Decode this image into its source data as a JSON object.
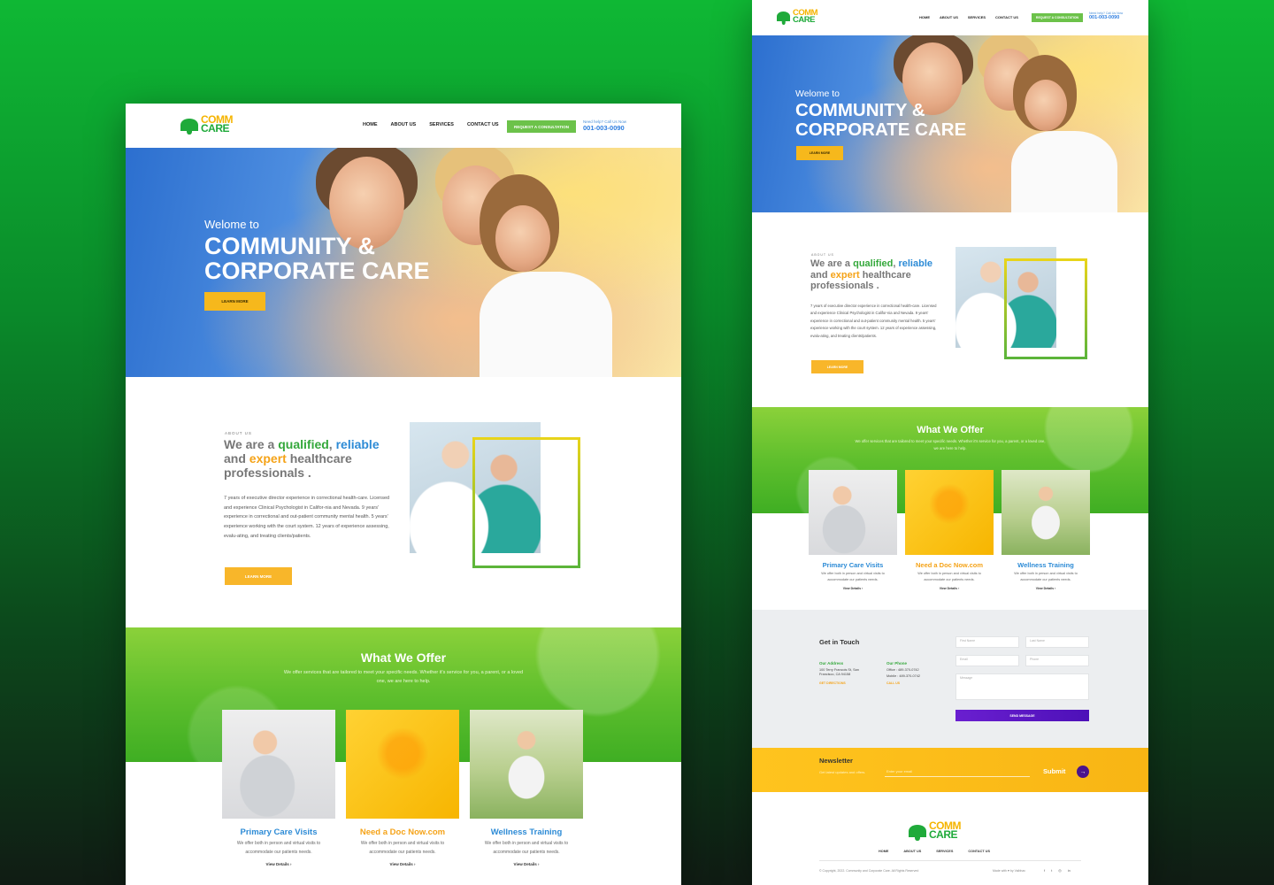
{
  "brand": {
    "line1": "COMM",
    "line2": "CARE"
  },
  "nav": {
    "home": "HOME",
    "about": "ABOUT US",
    "services": "SERVICES",
    "contact": "CONTACT US",
    "cta": "REQUEST A CONSULTATION"
  },
  "phone": {
    "label": "Need help? Call Us Now",
    "number": "001-003-0090"
  },
  "hero": {
    "welcome_left": "Welome to",
    "welcome_right": "Welome to",
    "title_line1": "COMMUNITY &",
    "title_line2": "CORPORATE CARE",
    "button": "LEARN MORE"
  },
  "about": {
    "label": "ABOUT US",
    "h_pre": "We are a ",
    "h_qualified": "qualified",
    "h_comma": ", ",
    "h_reliable": "reliable",
    "h_and": "and ",
    "h_expert": "expert",
    "h_rest": " healthcare",
    "h_last": "professionals .",
    "body": "7 years of executive director experience in correctional health-care. Licensed and experience Clinical Psychologist in Califor-nia and Nevada. 9 years' experience in correctional and out-patient community mental health. 5 years' experience working with the court system. 12 years of experience assessing, evalu-ating, and treating clients/patients.",
    "button": "LEARN MORE"
  },
  "offer": {
    "title": "What We Offer",
    "subtitle": "We offer services that are tailored to meet your specific needs. Whether it's service for you, a parent, or a loved one, we are here to help.",
    "cards": [
      {
        "title": "Primary Care Visits",
        "text": "We offer both in person and virtual visits to accommodate our patients needs.",
        "link": "View Details  ›"
      },
      {
        "title": "Need a Doc Now.com",
        "text": "We offer both in person and virtual visits to accommodate our patients needs.",
        "link": "View Details  ›"
      },
      {
        "title": "Wellness Training",
        "text": "We offer both in person and virtual visits to accommodate our patients needs.",
        "link": "View Details  ›"
      }
    ]
  },
  "contact": {
    "title": "Get in Touch",
    "address_label": "Our Address",
    "address": "100 Terry Francois St, San Francisco, CA 94158",
    "directions": "GET DIRECTIONS",
    "phone_label": "Our Phone",
    "office": "Office : 489-370-0742",
    "mobile": "Mobile : 489-370-0742",
    "call": "CALL US",
    "first_name": "First Name",
    "last_name": "Last Name",
    "email": "Email",
    "phone": "Phone",
    "message": "Message",
    "send": "SEND MESSAGE"
  },
  "newsletter": {
    "title": "Newsletter",
    "subtitle": "Get latest updates and offers.",
    "placeholder": "Enter your email",
    "submit": "Submit",
    "arrow": "→"
  },
  "footer": {
    "copyright": "© Copyright, 2022. Community and Corporate Care. All Rights Reserved",
    "made": "Made with ♥ by Vaibhav",
    "social": [
      "f",
      "t",
      "◎",
      "in"
    ]
  },
  "colors": {
    "green": "#34a83b",
    "yellow": "#f6b81c",
    "blue": "#2d8bd6",
    "orange": "#f5a318",
    "purple": "#5a17c4"
  }
}
